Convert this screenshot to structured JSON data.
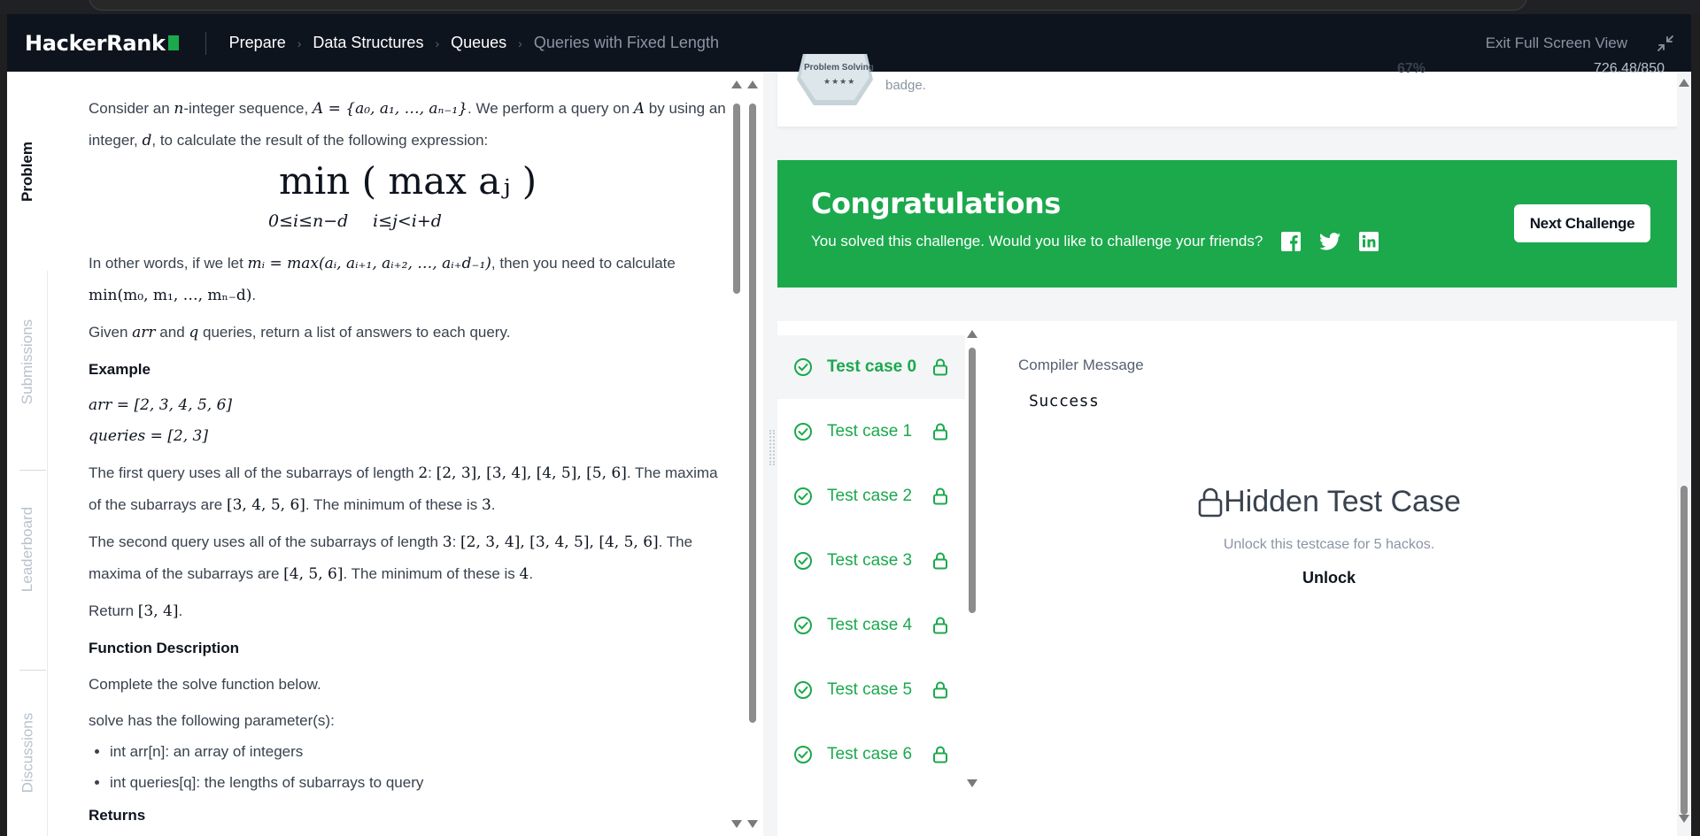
{
  "header": {
    "logo": "HackerRank",
    "breadcrumbs": [
      "Prepare",
      "Data Structures",
      "Queues",
      "Queries with Fixed Length"
    ],
    "exit_full_screen": "Exit Full Screen View"
  },
  "side_tabs": {
    "problem": "Problem",
    "submissions": "Submissions",
    "leaderboard": "Leaderboard",
    "discussions": "Discussions"
  },
  "problem": {
    "intro_1": "Consider an",
    "intro_n": "n",
    "intro_2": "-integer sequence,",
    "intro_seq": "A = {a₀, a₁, …, aₙ₋₁}",
    "intro_3": ". We perform a query on",
    "intro_A": "A",
    "intro_4": "by using an integer,",
    "intro_d": "d",
    "intro_5": ", to calculate the result of the following expression:",
    "display_main": "min ( max aⱼ )",
    "display_sub1": "0≤i≤n−d",
    "display_sub2": "i≤j<i+d",
    "other_words_1": "In other words, if we let",
    "other_words_mi": "mᵢ = max(aᵢ, aᵢ₊₁, aᵢ₊₂, …, aᵢ₊d₋₁)",
    "other_words_2": ", then you need to calculate",
    "other_words_min": "min(m₀, m₁, …, mₙ₋d)",
    "other_words_3": ".",
    "given_1": "Given",
    "given_arr": "arr",
    "given_2": "and",
    "given_q": "q",
    "given_3": "queries, return a list of answers to each query.",
    "example_title": "Example",
    "example_arr": "arr = [2, 3, 4, 5, 6]",
    "example_queries": "queries = [2, 3]",
    "first_query_1": "The first query uses all of the subarrays of length",
    "first_query_len": "2",
    "first_query_2": ":",
    "first_query_subs": "[2, 3], [3, 4], [4, 5], [5, 6]",
    "first_query_3": ". The maxima of the subarrays are",
    "first_query_max": "[3, 4, 5, 6]",
    "first_query_4": ". The minimum of these is",
    "first_query_min": "3",
    "first_query_5": ".",
    "second_query_1": "The second query uses all of the subarrays of length",
    "second_query_len": "3",
    "second_query_2": ":",
    "second_query_subs": "[2, 3, 4], [3, 4, 5], [4, 5, 6]",
    "second_query_3": ". The maxima of the subarrays are",
    "second_query_max": "[4, 5, 6]",
    "second_query_4": ". The minimum of these is",
    "second_query_min": "4",
    "second_query_5": ".",
    "return_1": "Return",
    "return_val": "[3, 4]",
    "return_2": ".",
    "function_title": "Function Description",
    "function_desc": "Complete the solve function below.",
    "params_intro": "solve has the following parameter(s):",
    "params": [
      "int arr[n]: an array of integers",
      "int queries[q]: the lengths of subarrays to query"
    ],
    "returns_title": "Returns"
  },
  "badge": {
    "label": "Problem Solving",
    "stars": "★★★★",
    "desc": "badge.",
    "percent": "67%",
    "score": "726.48/850"
  },
  "congrats": {
    "title": "Congratulations",
    "subtitle": "You solved this challenge. Would you like to challenge your friends?",
    "next_button": "Next Challenge",
    "accent": "#1ba94c"
  },
  "test_cases": [
    {
      "label": "Test case 0"
    },
    {
      "label": "Test case 1"
    },
    {
      "label": "Test case 2"
    },
    {
      "label": "Test case 3"
    },
    {
      "label": "Test case 4"
    },
    {
      "label": "Test case 5"
    },
    {
      "label": "Test case 6"
    }
  ],
  "result": {
    "compiler_label": "Compiler Message",
    "compiler_message": "Success",
    "hidden_title": "Hidden Test Case",
    "hidden_sub": "Unlock this testcase for 5 hackos.",
    "unlock": "Unlock"
  }
}
